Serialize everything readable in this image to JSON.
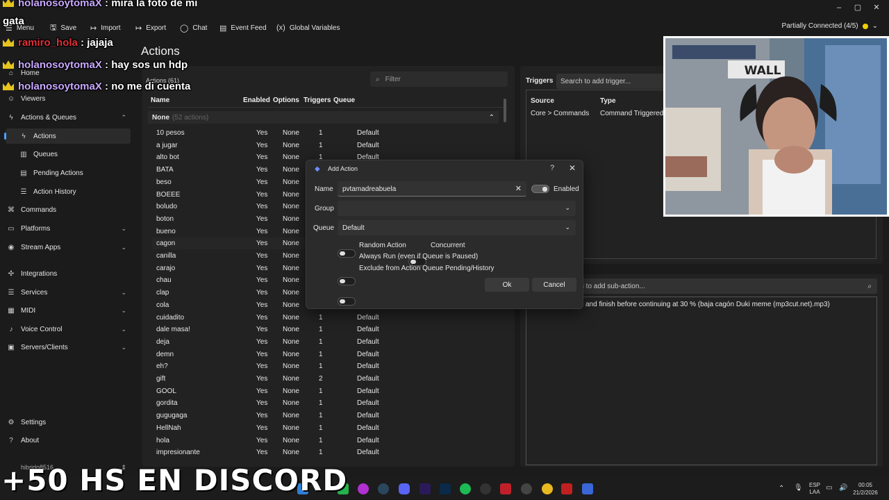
{
  "toolbar": {
    "menu": "Menu",
    "save": "Save",
    "import": "Import",
    "export": "Export",
    "chat": "Chat",
    "event_feed": "Event Feed",
    "global_variables": "Global Variables",
    "connection": "Partially Connected (4/5)",
    "connection_color": "#f0d000"
  },
  "sidebar": {
    "home": "Home",
    "viewers": "Viewers",
    "actions_queues": "Actions & Queues",
    "actions": "Actions",
    "queues": "Queues",
    "pending_actions": "Pending Actions",
    "action_history": "Action History",
    "commands": "Commands",
    "platforms": "Platforms",
    "stream_apps": "Stream Apps",
    "integrations": "Integrations",
    "services": "Services",
    "midi": "MIDI",
    "voice_control": "Voice Control",
    "servers_clients": "Servers/Clients",
    "settings": "Settings",
    "about": "About",
    "user": "hibrido8516"
  },
  "main": {
    "title": "Actions",
    "actions_count": "Actions (61)",
    "filter_placeholder": "Filter",
    "columns": {
      "name": "Name",
      "enabled": "Enabled",
      "options": "Options",
      "triggers": "Triggers",
      "queue": "Queue"
    },
    "group_name": "None",
    "group_count": "(52 actions)",
    "rows": [
      {
        "name": "10 pesos",
        "enabled": "Yes",
        "options": "None",
        "triggers": "1",
        "queue": "Default"
      },
      {
        "name": "a jugar",
        "enabled": "Yes",
        "options": "None",
        "triggers": "1",
        "queue": "Default"
      },
      {
        "name": "alto bot",
        "enabled": "Yes",
        "options": "None",
        "triggers": "1",
        "queue": "Default"
      },
      {
        "name": "BATA",
        "enabled": "Yes",
        "options": "None",
        "triggers": "",
        "queue": ""
      },
      {
        "name": "beso",
        "enabled": "Yes",
        "options": "None",
        "triggers": "",
        "queue": ""
      },
      {
        "name": "BOEEE",
        "enabled": "Yes",
        "options": "None",
        "triggers": "",
        "queue": ""
      },
      {
        "name": "boludo",
        "enabled": "Yes",
        "options": "None",
        "triggers": "",
        "queue": ""
      },
      {
        "name": "boton",
        "enabled": "Yes",
        "options": "None",
        "triggers": "",
        "queue": ""
      },
      {
        "name": "bueno",
        "enabled": "Yes",
        "options": "None",
        "triggers": "",
        "queue": ""
      },
      {
        "name": "cagon",
        "enabled": "Yes",
        "options": "None",
        "triggers": "",
        "queue": ""
      },
      {
        "name": "canilla",
        "enabled": "Yes",
        "options": "None",
        "triggers": "",
        "queue": ""
      },
      {
        "name": "carajo",
        "enabled": "Yes",
        "options": "None",
        "triggers": "",
        "queue": ""
      },
      {
        "name": "chau",
        "enabled": "Yes",
        "options": "None",
        "triggers": "",
        "queue": ""
      },
      {
        "name": "clap",
        "enabled": "Yes",
        "options": "None",
        "triggers": "",
        "queue": ""
      },
      {
        "name": "cola",
        "enabled": "Yes",
        "options": "None",
        "triggers": "",
        "queue": ""
      },
      {
        "name": "cuidadito",
        "enabled": "Yes",
        "options": "None",
        "triggers": "1",
        "queue": "Default"
      },
      {
        "name": "dale masa!",
        "enabled": "Yes",
        "options": "None",
        "triggers": "1",
        "queue": "Default"
      },
      {
        "name": "deja",
        "enabled": "Yes",
        "options": "None",
        "triggers": "1",
        "queue": "Default"
      },
      {
        "name": "demn",
        "enabled": "Yes",
        "options": "None",
        "triggers": "1",
        "queue": "Default"
      },
      {
        "name": "eh?",
        "enabled": "Yes",
        "options": "None",
        "triggers": "1",
        "queue": "Default"
      },
      {
        "name": "gift",
        "enabled": "Yes",
        "options": "None",
        "triggers": "2",
        "queue": "Default"
      },
      {
        "name": "GOOL",
        "enabled": "Yes",
        "options": "None",
        "triggers": "1",
        "queue": "Default"
      },
      {
        "name": "gordita",
        "enabled": "Yes",
        "options": "None",
        "triggers": "1",
        "queue": "Default"
      },
      {
        "name": "gugugaga",
        "enabled": "Yes",
        "options": "None",
        "triggers": "1",
        "queue": "Default"
      },
      {
        "name": "HellNah",
        "enabled": "Yes",
        "options": "None",
        "triggers": "1",
        "queue": "Default"
      },
      {
        "name": "hola",
        "enabled": "Yes",
        "options": "None",
        "triggers": "1",
        "queue": "Default"
      },
      {
        "name": "impresionante",
        "enabled": "Yes",
        "options": "None",
        "triggers": "1",
        "queue": "Default"
      }
    ]
  },
  "triggers": {
    "title": "Triggers",
    "search_placeholder": "Search to add trigger...",
    "col_source": "Source",
    "col_type": "Type",
    "source": "Core > Commands",
    "type": "Command Triggered"
  },
  "subactions": {
    "search_placeholder": "rch to add sub-action...",
    "item": "and finish before continuing at 30 % (baja cagón Duki meme (mp3cut.net).mp3)"
  },
  "dialog": {
    "title": "Add Action",
    "help": "?",
    "name_label": "Name",
    "name_value": "pvtamadreabuela",
    "enabled_label": "Enabled",
    "group_label": "Group",
    "group_value": "",
    "queue_label": "Queue",
    "queue_value": "Default",
    "random_action": "Random Action",
    "concurrent": "Concurrent",
    "always_run": "Always Run (even if Queue is Paused)",
    "exclude": "Exclude from Action Queue Pending/History",
    "ok": "Ok",
    "cancel": "Cancel"
  },
  "overlay": {
    "chat": [
      {
        "user": "holanosoytomaX",
        "msg": ": mira la foto de mi",
        "color": "#c9a8ff"
      },
      {
        "user": "",
        "msg": "gata",
        "color": "#ffffff"
      },
      {
        "user": "ramiro_hola",
        "msg": ": jajaja",
        "color": "#e0303a"
      },
      {
        "user": "holanosoytomaX",
        "msg": ": hay sos un hdp",
        "color": "#c9a8ff"
      },
      {
        "user": "holanosoytomaX",
        "msg": ": no me di cuenta",
        "color": "#c9a8ff"
      }
    ],
    "banner": "+50 HS EN DISCORD",
    "webcam_sign": "WALL"
  },
  "taskbar": {
    "lang": "ESP",
    "lang2": "LAA",
    "time": "00:05",
    "date": "21/2/2026"
  }
}
